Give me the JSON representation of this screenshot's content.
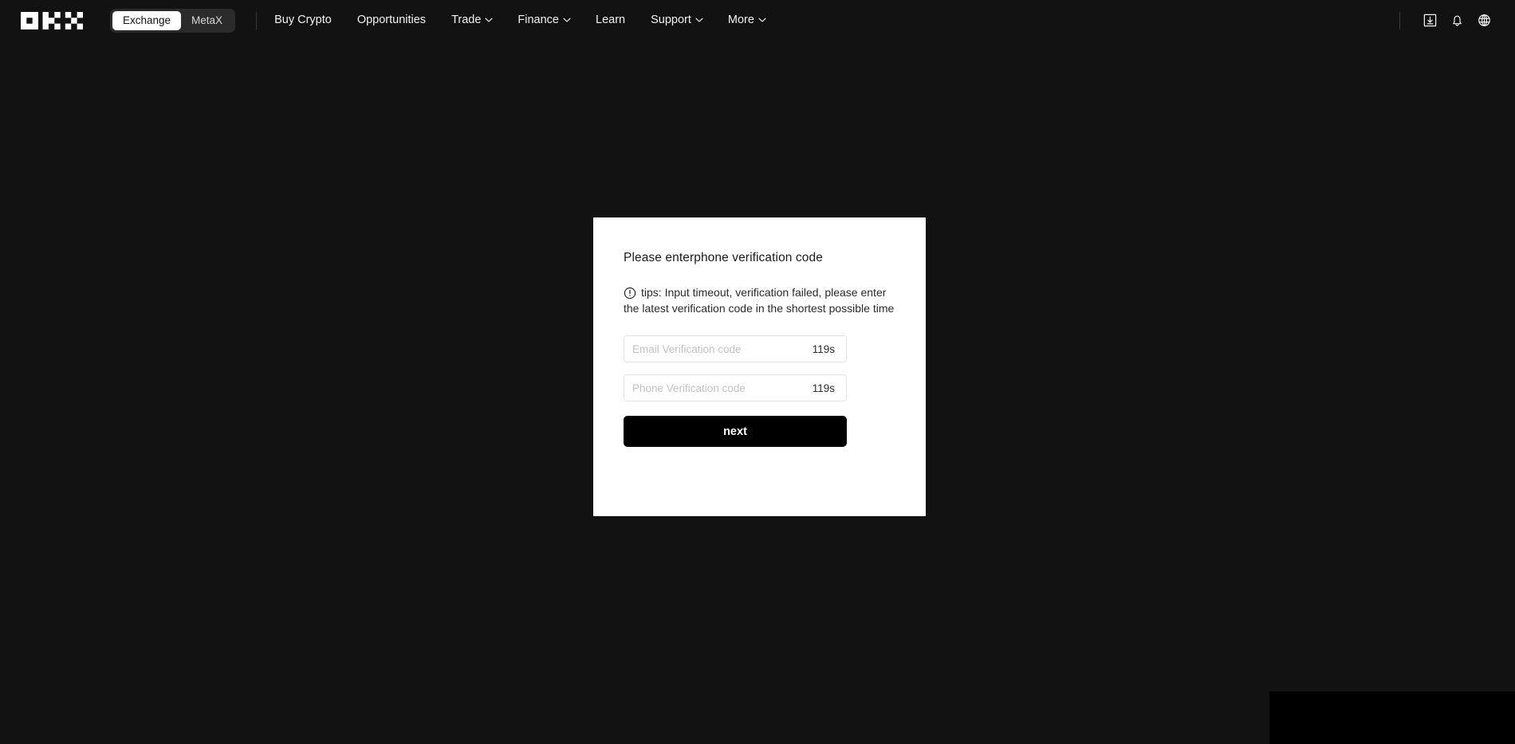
{
  "header": {
    "logo_name": "okx-logo",
    "segmented": {
      "items": [
        {
          "label": "Exchange",
          "active": true
        },
        {
          "label": "MetaX",
          "active": false
        }
      ]
    },
    "nav": [
      {
        "label": "Buy Crypto",
        "caret": false
      },
      {
        "label": "Opportunities",
        "caret": false
      },
      {
        "label": "Trade",
        "caret": true
      },
      {
        "label": "Finance",
        "caret": true
      },
      {
        "label": "Learn",
        "caret": false
      },
      {
        "label": "Support",
        "caret": true
      },
      {
        "label": "More",
        "caret": true
      }
    ],
    "icons": [
      {
        "name": "download-icon"
      },
      {
        "name": "bell-icon"
      },
      {
        "name": "globe-icon"
      }
    ]
  },
  "modal": {
    "title": "Please enterphone verification code",
    "tips_icon": "exclamation-circle-icon",
    "tips": "tips: Input timeout, verification failed, please enter the latest verification code in the shortest possible time",
    "email_field": {
      "placeholder": "Email Verification code",
      "value": "",
      "timer": "119s"
    },
    "phone_field": {
      "placeholder": "Phone Verification code",
      "value": "",
      "timer": "119s"
    },
    "submit_label": "next"
  },
  "colors": {
    "background": "#121212",
    "card": "#ffffff",
    "button": "#000000",
    "accent_text": "#f2f2f2"
  }
}
